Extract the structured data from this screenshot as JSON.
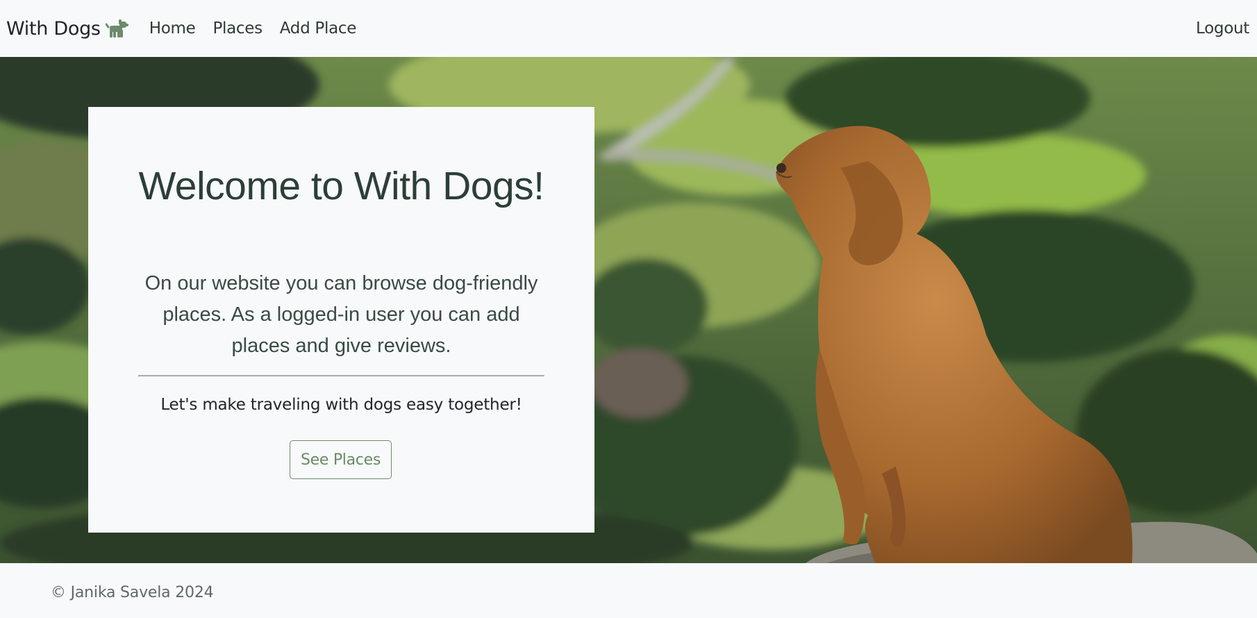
{
  "navbar": {
    "brand": "With Dogs",
    "brand_icon": "dog-icon",
    "links": [
      {
        "label": "Home"
      },
      {
        "label": "Places"
      },
      {
        "label": "Add Place"
      }
    ],
    "logout_label": "Logout"
  },
  "hero": {
    "title": "Welcome to With Dogs!",
    "lead": "On our website you can browse dog-friendly places. As a logged-in user you can add places and give reviews.",
    "tagline": "Let's make traveling with dogs easy together!",
    "button_label": "See Places"
  },
  "footer": {
    "copyright": "© Janika Savela 2024"
  },
  "colors": {
    "accent": "#6a8a66",
    "background": "#f8f9fa",
    "text": "#212529"
  }
}
